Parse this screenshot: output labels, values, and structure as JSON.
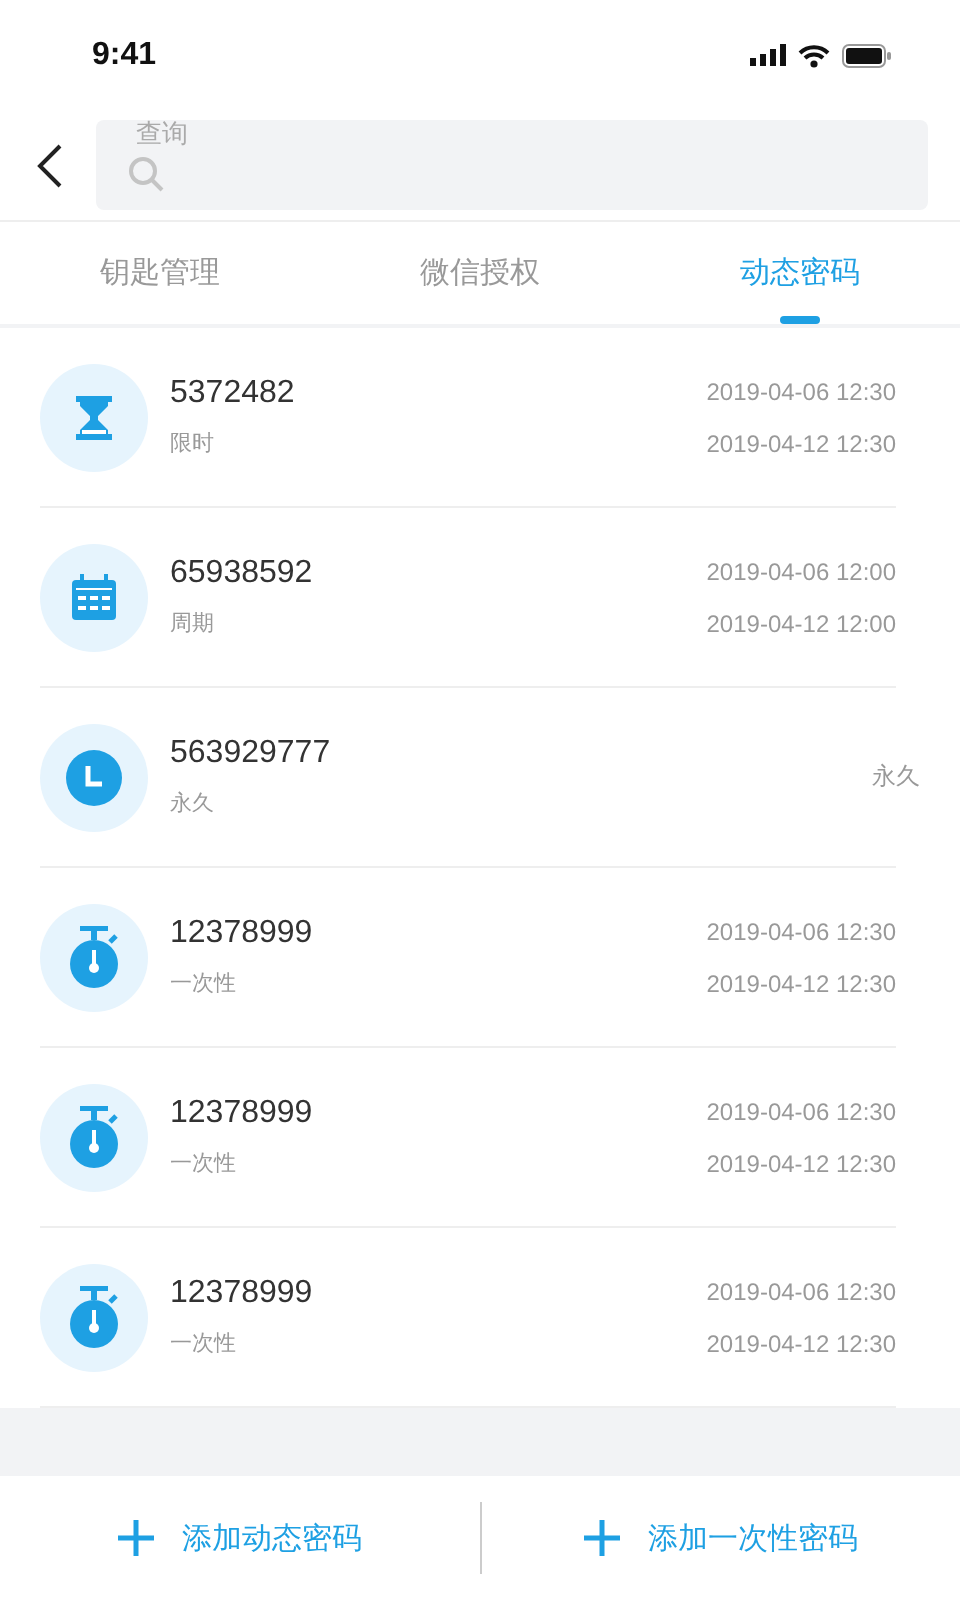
{
  "status_bar": {
    "time": "9:41"
  },
  "search": {
    "placeholder": "查询"
  },
  "tabs": [
    {
      "label": "钥匙管理",
      "selected": false
    },
    {
      "label": "微信授权",
      "selected": false
    },
    {
      "label": "动态密码",
      "selected": true
    }
  ],
  "passwords": [
    {
      "kind": "timed",
      "code": "5372482",
      "type_label": "限时",
      "dates": [
        "2019-04-06 12:30",
        "2019-04-12 12:30"
      ]
    },
    {
      "kind": "periodic",
      "code": "65938592",
      "type_label": "周期",
      "dates": [
        "2019-04-06 12:00",
        "2019-04-12 12:00"
      ]
    },
    {
      "kind": "permanent",
      "code": "563929777",
      "type_label": "永久",
      "dates": [
        "永久"
      ]
    },
    {
      "kind": "once",
      "code": "12378999",
      "type_label": "一次性",
      "dates": [
        "2019-04-06 12:30",
        "2019-04-12 12:30"
      ]
    },
    {
      "kind": "once",
      "code": "12378999",
      "type_label": "一次性",
      "dates": [
        "2019-04-06 12:30",
        "2019-04-12 12:30"
      ]
    },
    {
      "kind": "once",
      "code": "12378999",
      "type_label": "一次性",
      "dates": [
        "2019-04-06 12:30",
        "2019-04-12 12:30"
      ]
    }
  ],
  "actions": [
    {
      "label": "添加动态密码"
    },
    {
      "label": "添加一次性密码"
    }
  ]
}
